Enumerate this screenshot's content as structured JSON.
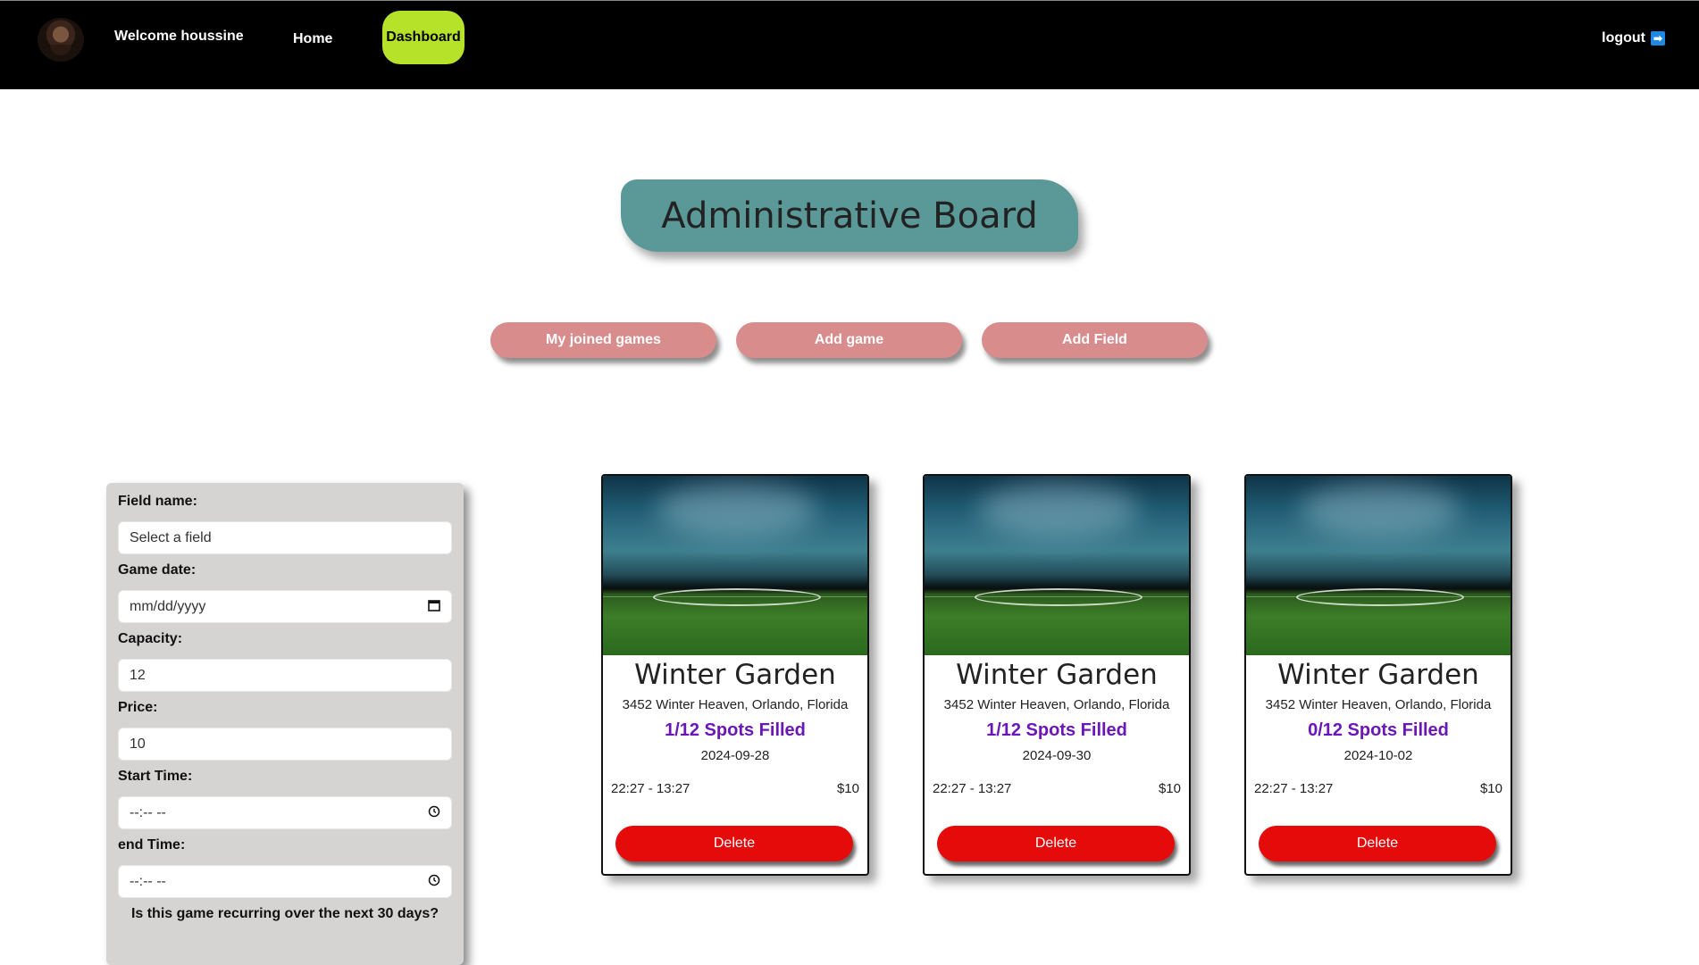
{
  "nav": {
    "welcome": "Welcome houssine",
    "home": "Home",
    "dashboard": "Dashboard",
    "logout": "logout",
    "logout_icon": "➡"
  },
  "board": {
    "title": "Administrative Board"
  },
  "actions": [
    {
      "label": "My joined games"
    },
    {
      "label": "Add game"
    },
    {
      "label": "Add Field"
    }
  ],
  "form": {
    "field_name": {
      "label": "Field name:",
      "value": "Select a field"
    },
    "game_date": {
      "label": "Game date:",
      "value": "mm/dd/yyyy",
      "icon": "calendar-icon"
    },
    "capacity": {
      "label": "Capacity:",
      "value": "12"
    },
    "price": {
      "label": "Price:",
      "value": "10"
    },
    "start_time": {
      "label": "Start Time:",
      "value": "--:-- --",
      "icon": "clock-icon"
    },
    "end_time": {
      "label": "end Time:",
      "value": "--:-- --",
      "icon": "clock-icon"
    },
    "recurring_question": "Is this game recurring over the next 30 days?"
  },
  "cards": [
    {
      "title": "Winter Garden",
      "address": "3452 Winter Heaven, Orlando, Florida",
      "spots": "1/12 Spots Filled",
      "date": "2024-09-28",
      "time": "22:27 - 13:27",
      "price": "$10",
      "delete": "Delete"
    },
    {
      "title": "Winter Garden",
      "address": "3452 Winter Heaven, Orlando, Florida",
      "spots": "1/12 Spots Filled",
      "date": "2024-09-30",
      "time": "22:27 - 13:27",
      "price": "$10",
      "delete": "Delete"
    },
    {
      "title": "Winter Garden",
      "address": "3452 Winter Heaven, Orlando, Florida",
      "spots": "0/12 Spots Filled",
      "date": "2024-10-02",
      "time": "22:27 - 13:27",
      "price": "$10",
      "delete": "Delete"
    }
  ],
  "colors": {
    "navbar": "#000000",
    "dashboard_active": "#b6e32a",
    "title_bg": "#5b9898",
    "action_btn": "#d98c8c",
    "form_bg": "#d6d3d3",
    "spots_text": "#6b16b8",
    "delete_btn": "#e60b0b"
  }
}
